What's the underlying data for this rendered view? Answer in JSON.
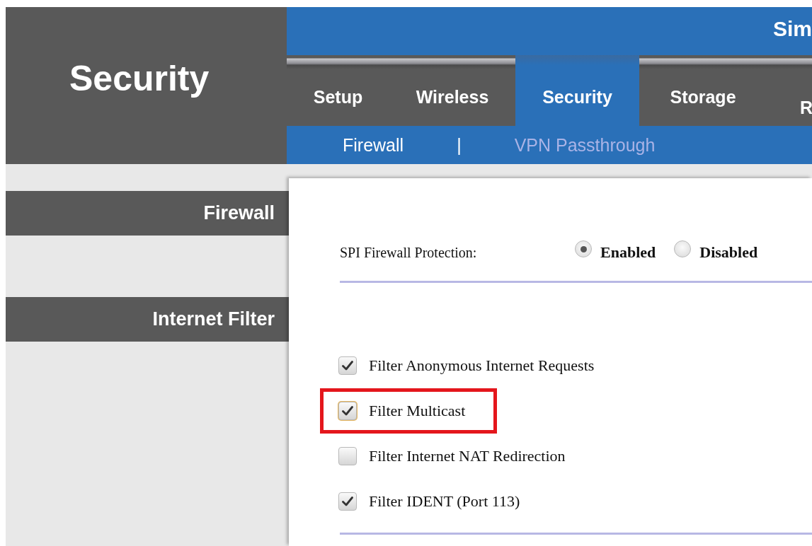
{
  "header": {
    "title": "Security",
    "banner_text": "Sim"
  },
  "tabs": [
    {
      "label": "Setup",
      "selected": false
    },
    {
      "label": "Wireless",
      "selected": false
    },
    {
      "label": "Security",
      "selected": true
    },
    {
      "label": "Storage",
      "selected": false
    },
    {
      "label": "R",
      "selected": false
    }
  ],
  "subtabs": [
    {
      "label": "Firewall",
      "selected": true
    },
    {
      "label": "VPN Passthrough",
      "selected": false
    }
  ],
  "subtab_separator": "|",
  "sidebar": {
    "sections": [
      "Firewall",
      "Internet Filter"
    ]
  },
  "spi_firewall": {
    "label": "SPI Firewall Protection:",
    "options": [
      {
        "label": "Enabled",
        "selected": true
      },
      {
        "label": "Disabled",
        "selected": false
      }
    ]
  },
  "filters": [
    {
      "label": "Filter Anonymous Internet Requests",
      "checked": true,
      "focused": false,
      "highlighted": false
    },
    {
      "label": "Filter Multicast",
      "checked": true,
      "focused": true,
      "highlighted": true
    },
    {
      "label": "Filter Internet NAT Redirection",
      "checked": false,
      "focused": false,
      "highlighted": false
    },
    {
      "label": "Filter IDENT (Port 113)",
      "checked": true,
      "focused": false,
      "highlighted": false
    }
  ]
}
